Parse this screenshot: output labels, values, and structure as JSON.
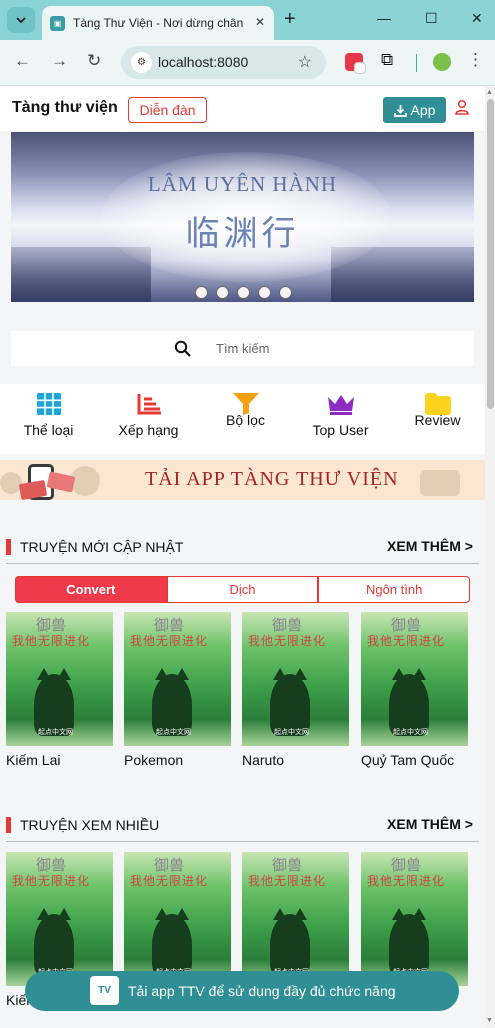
{
  "browser": {
    "tab_title": "Tàng Thư Viện - Nơi dừng chân",
    "url": "localhost:8080"
  },
  "header": {
    "brand": "Tàng thư viện",
    "forum_label": "Diễn đàn",
    "app_label": "App"
  },
  "banner": {
    "title": "LÂM UYÊN HÀNH",
    "subtitle": "临渊行",
    "slide_count": 5
  },
  "search": {
    "placeholder": "Tìm kiếm"
  },
  "quicknav": [
    {
      "label": "Thể loại",
      "icon": "grid-icon"
    },
    {
      "label": "Xếp hạng",
      "icon": "ranking-chart-icon"
    },
    {
      "label": "Bộ lọc",
      "icon": "filter-icon"
    },
    {
      "label": "Top User",
      "icon": "crown-icon"
    },
    {
      "label": "Review",
      "icon": "folder-icon"
    }
  ],
  "promo": {
    "text": "TẢI APP TÀNG THƯ VIỆN"
  },
  "sections": [
    {
      "title": "TRUYỆN MỚI CẬP NHẬT",
      "more": "XEM THÊM >",
      "tabs": [
        "Convert",
        "Dịch",
        "Ngôn tình"
      ],
      "active_tab": "Convert",
      "books": [
        "Kiếm Lai",
        "Pokemon",
        "Naruto",
        "Quỷ Tam Quốc"
      ]
    },
    {
      "title": "TRUYỆN XEM NHIỀU",
      "more": "XEM THÊM >",
      "books": [
        "Kiếm Lai"
      ]
    }
  ],
  "cover": {
    "top_text": "御兽",
    "title_text": "我他无限进化",
    "publisher": "起点中文网"
  },
  "bottom_banner": {
    "logo_text": "TV",
    "text": "Tải app TTV để sử dụng đầy đủ chức năng"
  },
  "colors": {
    "accent": "#e53935",
    "brand": "#2f8f94",
    "chrome": "#8bd4d6"
  }
}
